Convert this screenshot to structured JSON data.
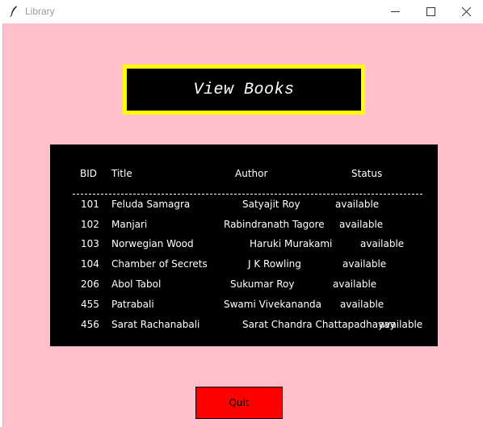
{
  "window": {
    "title": "Library",
    "app_icon": "feather-icon",
    "controls": [
      "minimize-icon",
      "maximize-icon",
      "close-icon"
    ]
  },
  "heading": {
    "text": "View Books",
    "background": "#000000",
    "border_color": "#ffff00",
    "text_color": "#ffffff"
  },
  "table": {
    "headers": {
      "bid": "BID",
      "title": "Title",
      "author": "Author",
      "status": "Status"
    },
    "divider": "----------------------------------------------------------------------------",
    "rows": [
      {
        "bid": "101",
        "title": "Feluda Samagra",
        "author": "Satyajit Roy",
        "status": "available"
      },
      {
        "bid": "102",
        "title": "Manjari",
        "author": "Rabindranath Tagore",
        "status": "available"
      },
      {
        "bid": "103",
        "title": "Norwegian Wood",
        "author": "Haruki Murakami",
        "status": "available"
      },
      {
        "bid": "104",
        "title": "Chamber of Secrets",
        "author": "J K Rowling",
        "status": "available"
      },
      {
        "bid": "206",
        "title": "Abol Tabol",
        "author": "Sukumar Roy",
        "status": "available"
      },
      {
        "bid": "455",
        "title": "Patrabali",
        "author": "Swami Vivekananda",
        "status": "available"
      },
      {
        "bid": "456",
        "title": "Sarat Rachanabali",
        "author": "Sarat Chandra Chattapadhayay",
        "status": "available"
      }
    ]
  },
  "quit_button": {
    "label": "Quit",
    "background": "#ff0000"
  },
  "colors": {
    "window_background": "#ffc0cb",
    "panel_background": "#000000"
  }
}
